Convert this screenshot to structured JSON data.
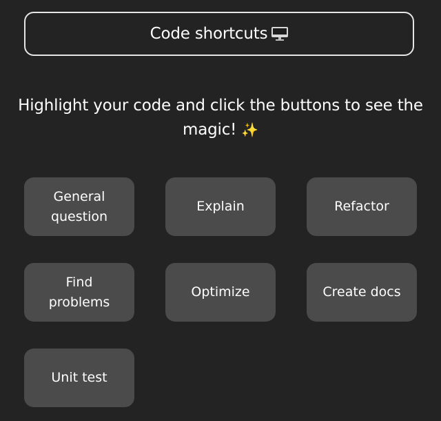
{
  "header": {
    "title": "Code shortcuts",
    "icon": "monitor-icon"
  },
  "intro": {
    "text": "Highlight your code and click the buttons to see the magic!",
    "emoji": "✨"
  },
  "buttons": [
    {
      "label": "General\nquestion"
    },
    {
      "label": "Explain"
    },
    {
      "label": "Refactor"
    },
    {
      "label": "Find\nproblems"
    },
    {
      "label": "Optimize"
    },
    {
      "label": "Create docs"
    },
    {
      "label": "Unit test"
    }
  ],
  "colors": {
    "background": "#232323",
    "button": "#4b4b4b",
    "border": "#e6e6e6",
    "text": "#ffffff"
  }
}
